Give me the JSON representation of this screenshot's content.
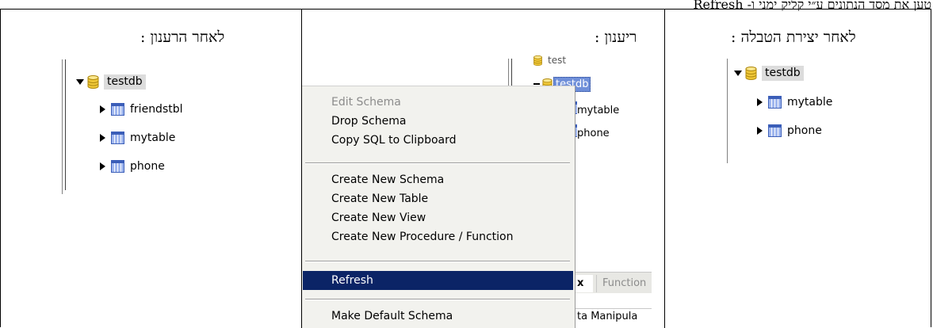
{
  "header": {
    "text": "טען את מסד הנתונים ע״י קליק ימני ו- Refresh"
  },
  "columns": {
    "after_refresh": {
      "title": "לאחר הרענון :",
      "db_name": "testdb",
      "tables": [
        "friendstbl",
        "mytable",
        "phone"
      ]
    },
    "refresh": {
      "title": "ריענון :",
      "partial_db_above": "test",
      "db_name": "testdb",
      "tables": [
        "mytable",
        "phone"
      ],
      "tabs": {
        "active": "x",
        "inactive": "Function"
      },
      "bottom_text": "ta Manipula"
    },
    "after_create": {
      "title": "לאחר יצירת הטבלה :",
      "db_name": "testdb",
      "tables": [
        "mytable",
        "phone"
      ]
    }
  },
  "context_menu": {
    "items": [
      {
        "label": "Edit Schema",
        "state": "disabled"
      },
      {
        "label": "Drop Schema",
        "state": "normal"
      },
      {
        "label": "Copy SQL to Clipboard",
        "state": "normal"
      },
      {
        "label": "Create New Schema",
        "state": "normal"
      },
      {
        "label": "Create New Table",
        "state": "normal"
      },
      {
        "label": "Create New View",
        "state": "normal"
      },
      {
        "label": "Create New Procedure / Function",
        "state": "normal"
      },
      {
        "label": "Refresh",
        "state": "selected"
      },
      {
        "label": "Make Default Schema",
        "state": "normal"
      }
    ]
  },
  "colors": {
    "selection": "#0b2466",
    "db_icon": "#f0c838",
    "table_icon": "#6f8fd9",
    "menu_bg": "#f2f2ee"
  },
  "icons": {
    "database": "database-cylinder-icon",
    "table": "table-grid-icon",
    "expanded": "triangle-down-icon",
    "collapsed": "triangle-right-icon"
  }
}
